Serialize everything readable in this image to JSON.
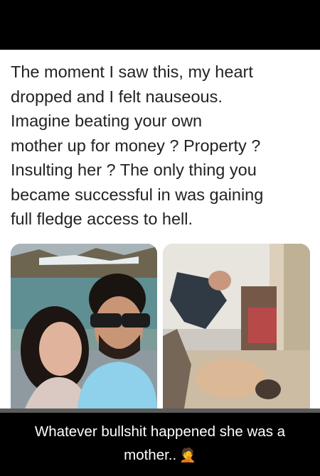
{
  "post": {
    "text": "The moment I saw this, my heart\ndropped and I felt nauseous.\nImagine beating your own\nmother up for money ? Property ?\nInsulting her ? The only thing you\nbecame successful in was gaining\nfull fledge access to hell."
  },
  "caption": {
    "text": "Whatever bullshit happened she was a mother..",
    "emoji": "🤦"
  },
  "colors": {
    "card_background": "#ffffff",
    "screen_background": "#000000",
    "body_text": "#222222",
    "caption_text": "#ffffff"
  }
}
